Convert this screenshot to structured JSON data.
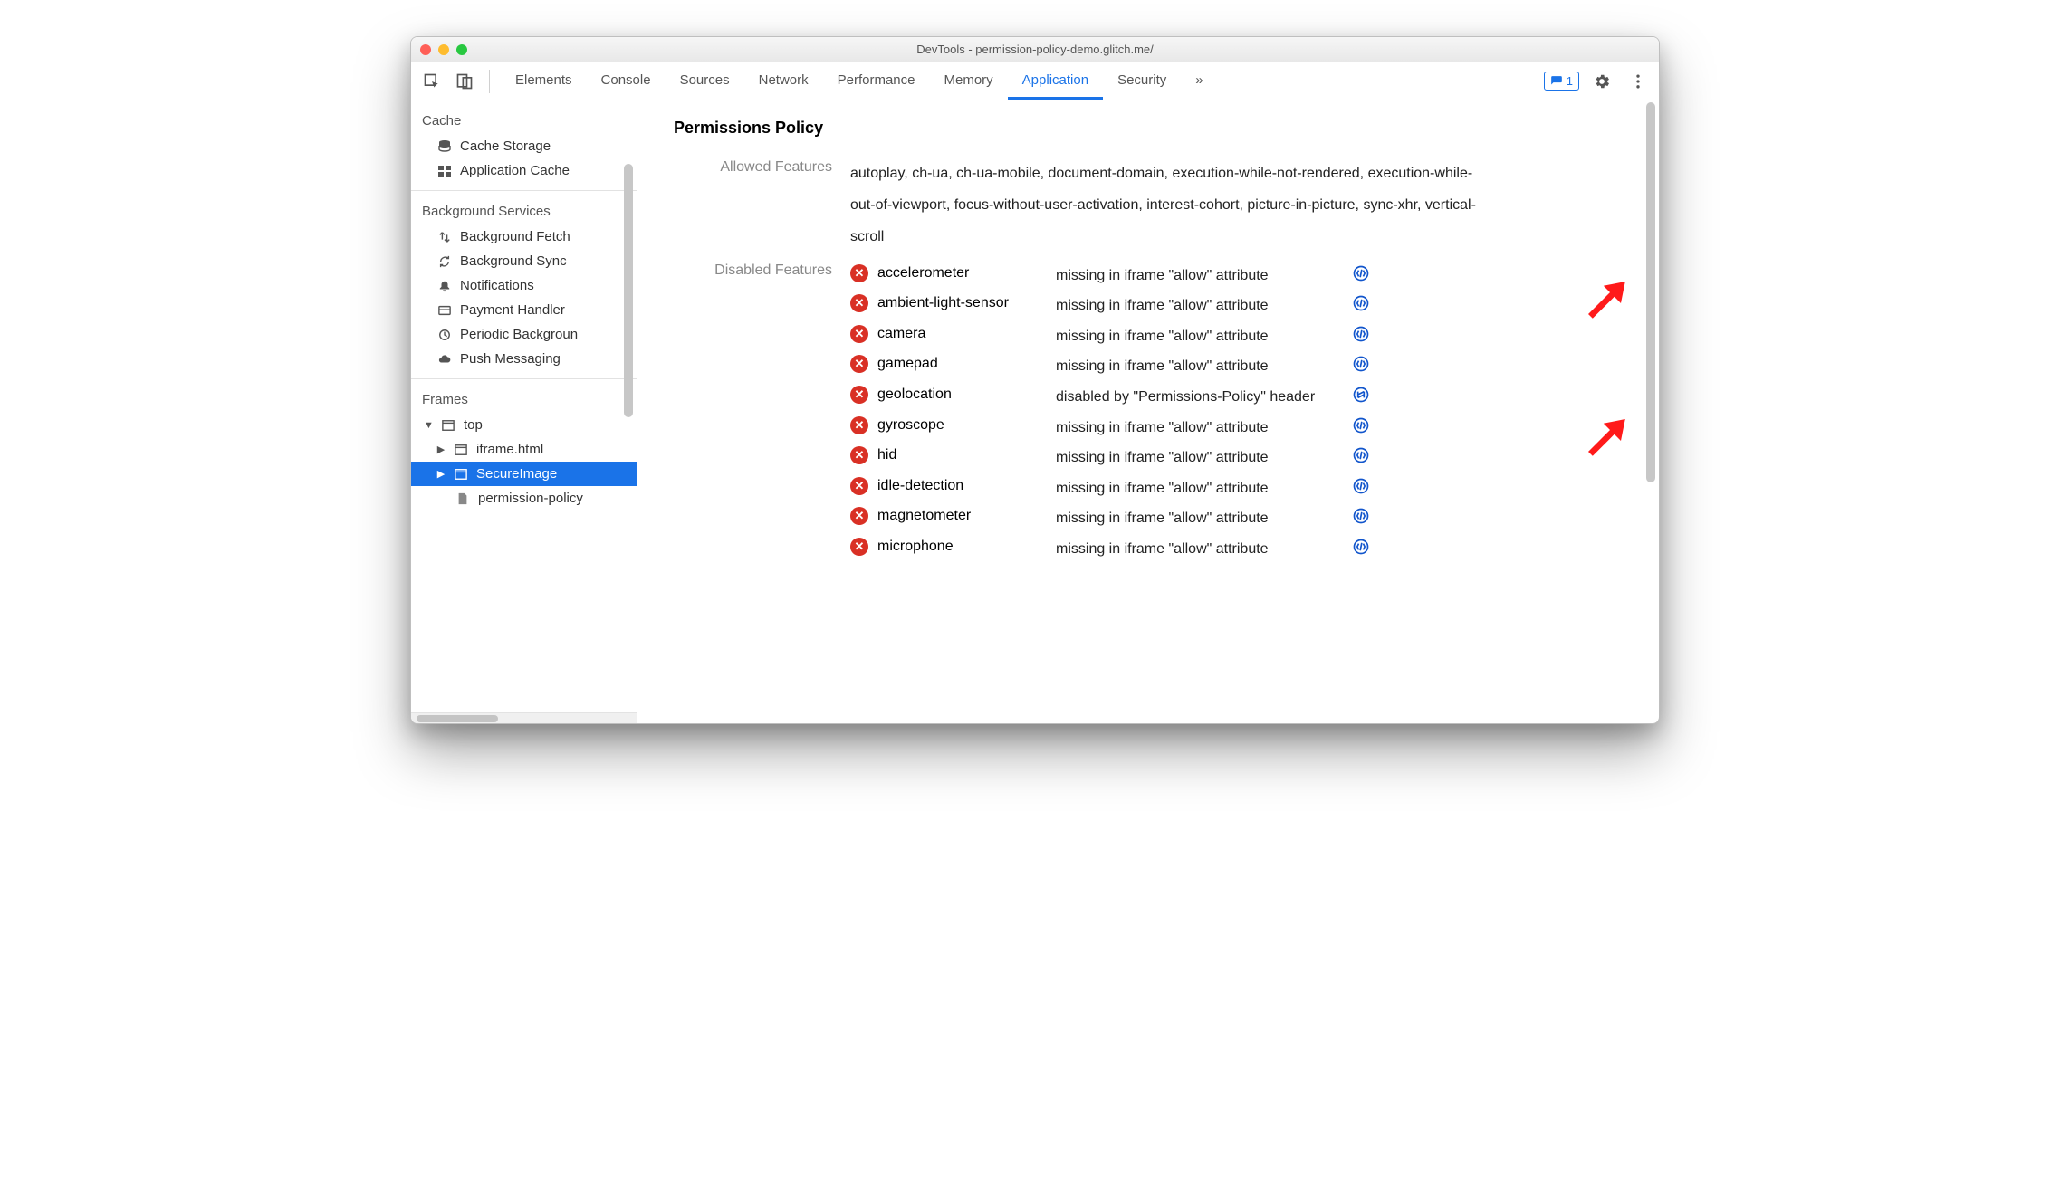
{
  "window_title": "DevTools - permission-policy-demo.glitch.me/",
  "tabs": [
    "Elements",
    "Console",
    "Sources",
    "Network",
    "Performance",
    "Memory",
    "Application",
    "Security"
  ],
  "active_tab": "Application",
  "feedback_count": "1",
  "sidebar": {
    "cache_title": "Cache",
    "cache_items": [
      "Cache Storage",
      "Application Cache"
    ],
    "bg_title": "Background Services",
    "bg_items": [
      "Background Fetch",
      "Background Sync",
      "Notifications",
      "Payment Handler",
      "Periodic Backgroun",
      "Push Messaging"
    ],
    "frames_title": "Frames",
    "frames": {
      "top": "top",
      "children": [
        "iframe.html",
        "SecureImage",
        "permission-policy"
      ]
    }
  },
  "panel": {
    "heading": "Permissions Policy",
    "allowed_label": "Allowed Features",
    "allowed_text": "autoplay, ch-ua, ch-ua-mobile, document-domain, execution-while-not-rendered, execution-while-out-of-viewport, focus-without-user-activation, interest-cohort, picture-in-picture, sync-xhr, vertical-scroll",
    "disabled_label": "Disabled Features",
    "disabled": [
      {
        "name": "accelerometer",
        "reason": "missing in iframe \"allow\" attribute",
        "icon": "elements"
      },
      {
        "name": "ambient-light-sensor",
        "reason": "missing in iframe \"allow\" attribute",
        "icon": "elements"
      },
      {
        "name": "camera",
        "reason": "missing in iframe \"allow\" attribute",
        "icon": "elements"
      },
      {
        "name": "gamepad",
        "reason": "missing in iframe \"allow\" attribute",
        "icon": "elements"
      },
      {
        "name": "geolocation",
        "reason": "disabled by \"Permissions-Policy\" header",
        "icon": "network"
      },
      {
        "name": "gyroscope",
        "reason": "missing in iframe \"allow\" attribute",
        "icon": "elements"
      },
      {
        "name": "hid",
        "reason": "missing in iframe \"allow\" attribute",
        "icon": "elements"
      },
      {
        "name": "idle-detection",
        "reason": "missing in iframe \"allow\" attribute",
        "icon": "elements"
      },
      {
        "name": "magnetometer",
        "reason": "missing in iframe \"allow\" attribute",
        "icon": "elements"
      },
      {
        "name": "microphone",
        "reason": "missing in iframe \"allow\" attribute",
        "icon": "elements"
      }
    ]
  }
}
